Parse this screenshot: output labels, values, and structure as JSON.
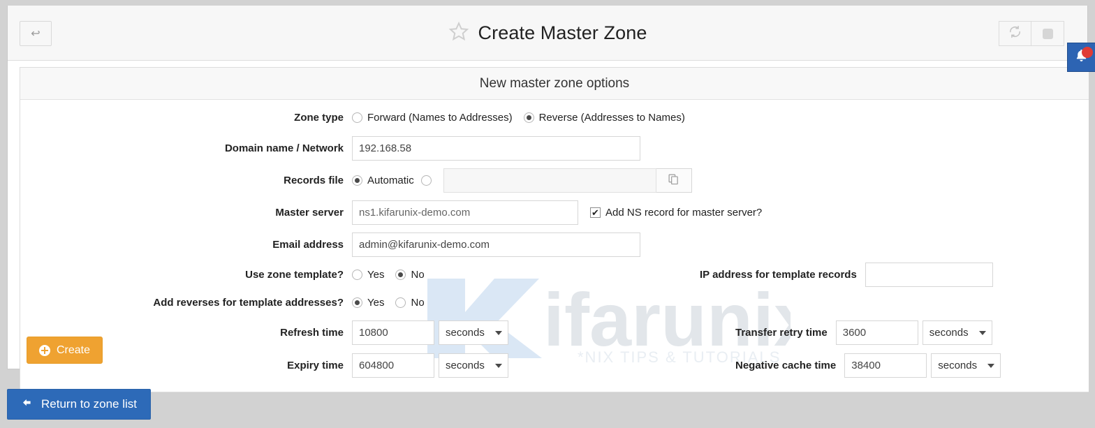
{
  "header": {
    "title": "Create Master Zone",
    "back_label": "↩",
    "star_icon": "star-outline-icon",
    "refresh_icon": "refresh-icon",
    "stop_icon": "stop-icon"
  },
  "notification": {
    "icon": "bell-icon",
    "badge_color": "#e03b36",
    "background": "#2d64b3"
  },
  "watermark": {
    "brand": "Kifarunix",
    "brand_prefix": "K",
    "brand_rest": "ifarunix",
    "tagline": "*NIX TIPS & TUTORIALS"
  },
  "panel": {
    "heading": "New master zone options"
  },
  "form": {
    "zone_type": {
      "label": "Zone type",
      "options": [
        {
          "label": "Forward (Names to Addresses)",
          "selected": false
        },
        {
          "label": "Reverse (Addresses to Names)",
          "selected": true
        }
      ]
    },
    "domain_name": {
      "label": "Domain name / Network",
      "value": "192.168.58"
    },
    "records_file": {
      "label": "Records file",
      "automatic_label": "Automatic",
      "automatic_selected": true,
      "custom_selected": false,
      "custom_value": "",
      "picker_icon": "file-chooser-icon"
    },
    "master_server": {
      "label": "Master server",
      "value": "ns1.kifarunix-demo.com",
      "checkbox_label": "Add NS record for master server?",
      "checkbox_checked": true,
      "check_glyph": "✔"
    },
    "email_address": {
      "label": "Email address",
      "value": "admin@kifarunix-demo.com"
    },
    "use_zone_template": {
      "label": "Use zone template?",
      "yes_label": "Yes",
      "no_label": "No",
      "selected": "No"
    },
    "ip_for_template_records": {
      "label": "IP address for template records",
      "value": ""
    },
    "add_reverses": {
      "label": "Add reverses for template addresses?",
      "yes_label": "Yes",
      "no_label": "No",
      "selected": "Yes"
    },
    "refresh_time": {
      "label": "Refresh time",
      "value": "10800",
      "unit": "seconds"
    },
    "transfer_retry_time": {
      "label": "Transfer retry time",
      "value": "3600",
      "unit": "seconds"
    },
    "expiry_time": {
      "label": "Expiry time",
      "value": "604800",
      "unit": "seconds"
    },
    "negative_cache_time": {
      "label": "Negative cache time",
      "value": "38400",
      "unit": "seconds"
    }
  },
  "buttons": {
    "create": {
      "label": "Create",
      "icon": "plus-circle-icon",
      "color": "#efa231"
    },
    "return": {
      "label": "Return to zone list",
      "icon": "arrow-left-icon",
      "color": "#2d6ab8"
    }
  }
}
